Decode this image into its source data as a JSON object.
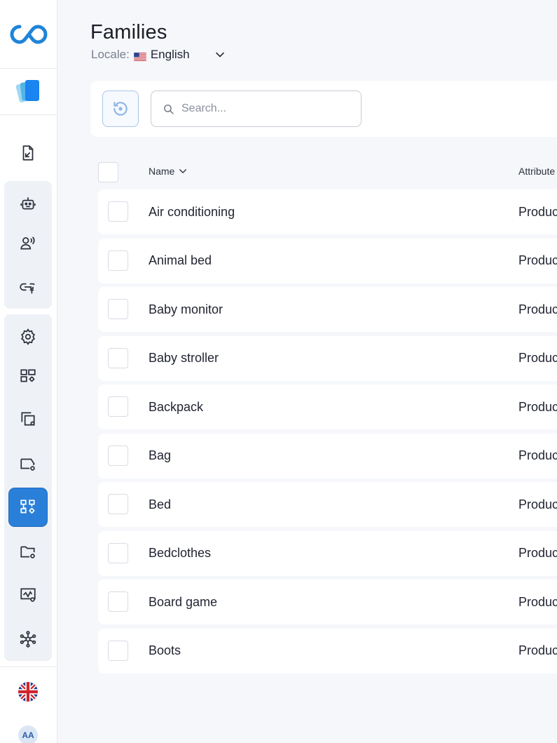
{
  "page": {
    "title": "Families",
    "locale_label": "Locale:",
    "locale_value": "English"
  },
  "search": {
    "placeholder": "Search..."
  },
  "table": {
    "columns": {
      "name": "Name",
      "attribute": "Attribute"
    },
    "rows": [
      {
        "name": "Air conditioning",
        "attribute": "Product"
      },
      {
        "name": "Animal bed",
        "attribute": "Product"
      },
      {
        "name": "Baby monitor",
        "attribute": "Product"
      },
      {
        "name": "Baby stroller",
        "attribute": "Product"
      },
      {
        "name": "Backpack",
        "attribute": "Product"
      },
      {
        "name": "Bag",
        "attribute": "Product"
      },
      {
        "name": "Bed",
        "attribute": "Product"
      },
      {
        "name": "Bedclothes",
        "attribute": "Product"
      },
      {
        "name": "Board game",
        "attribute": "Product"
      },
      {
        "name": "Boots",
        "attribute": "Product"
      }
    ]
  },
  "user": {
    "initials": "AA"
  },
  "colors": {
    "accent": "#2a7fd9",
    "background": "#f5f7fb",
    "sidebar_group": "#eef1f6",
    "border": "#d9dce4"
  },
  "icons": {
    "logo": "infinity-logo-icon",
    "app": "cards-app-icon",
    "nav": [
      "file-import-icon",
      "robot-icon",
      "voice-user-icon",
      "plug-link-icon",
      "gear-icon",
      "grid-settings-icon",
      "copy-settings-icon",
      "tag-settings-icon",
      "hierarchy-settings-icon",
      "folder-settings-icon",
      "chart-settings-icon",
      "network-icon"
    ]
  }
}
